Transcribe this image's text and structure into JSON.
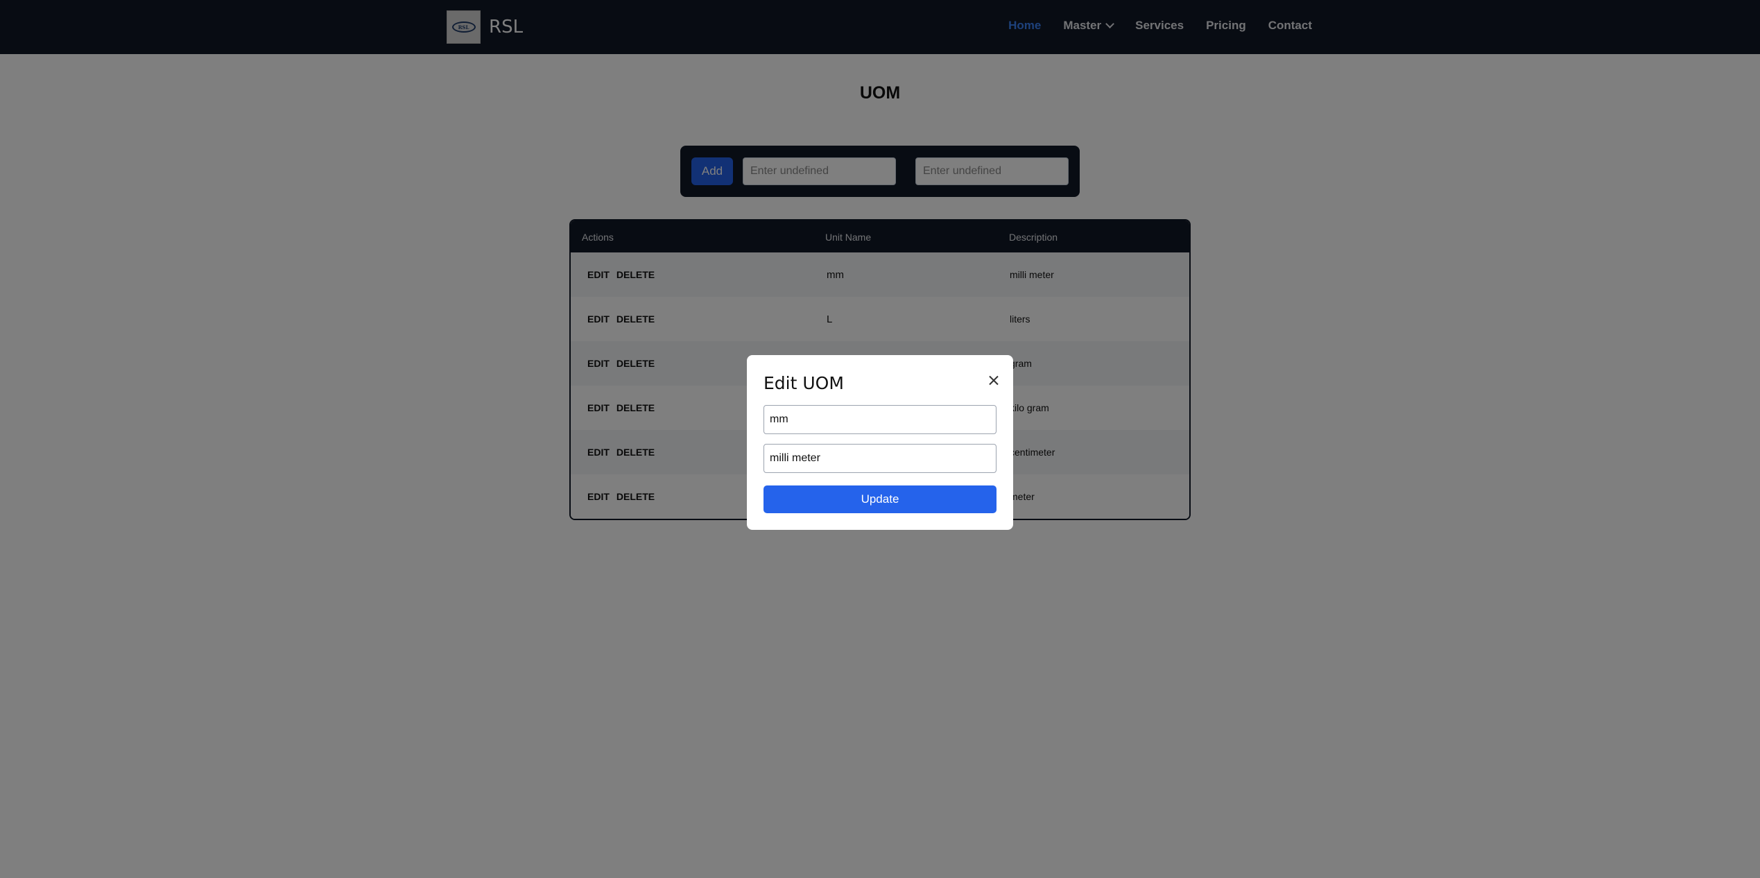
{
  "navbar": {
    "brand": "RSL",
    "logo_text": "RSL",
    "links": [
      {
        "label": "Home",
        "active": true
      },
      {
        "label": "Master",
        "has_dropdown": true
      },
      {
        "label": "Services"
      },
      {
        "label": "Pricing"
      },
      {
        "label": "Contact"
      }
    ]
  },
  "page": {
    "title": "UOM"
  },
  "add_form": {
    "button_label": "Add",
    "unit_placeholder": "Enter undefined",
    "description_placeholder": "Enter undefined"
  },
  "table": {
    "headers": [
      "Actions",
      "Unit Name",
      "Description"
    ],
    "edit_label": "EDIT",
    "delete_label": "DELETE",
    "rows": [
      {
        "unit": "mm",
        "description": "milli meter"
      },
      {
        "unit": "L",
        "description": "liters"
      },
      {
        "unit": "",
        "description": "gram"
      },
      {
        "unit": "",
        "description": "kilo gram"
      },
      {
        "unit": "",
        "description": "centimeter"
      },
      {
        "unit": "",
        "description": "meter"
      }
    ]
  },
  "modal": {
    "title": "Edit UOM",
    "unit_value": "mm",
    "description_value": "milli meter",
    "update_label": "Update"
  },
  "colors": {
    "navbar_bg": "#111827",
    "accent": "#2563eb",
    "active_link": "#3b82f6"
  }
}
